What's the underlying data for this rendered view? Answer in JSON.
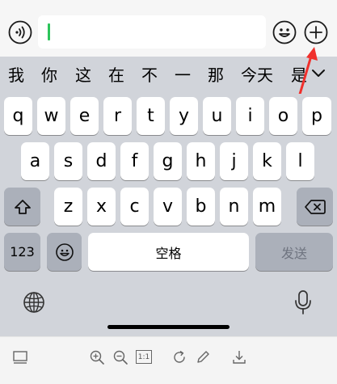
{
  "input_bar": {
    "voice_icon": "voice-input-icon",
    "emoji_icon": "emoji-icon",
    "plus_icon": "plus-icon",
    "text_value": ""
  },
  "candidates": [
    "我",
    "你",
    "这",
    "在",
    "不",
    "一",
    "那",
    "今天",
    "是"
  ],
  "annotation": {
    "arrow_color": "#f0302c"
  },
  "keyboard": {
    "row1": [
      "q",
      "w",
      "e",
      "r",
      "t",
      "y",
      "u",
      "i",
      "o",
      "p"
    ],
    "row2": [
      "a",
      "s",
      "d",
      "f",
      "g",
      "h",
      "j",
      "k",
      "l"
    ],
    "row3": [
      "z",
      "x",
      "c",
      "v",
      "b",
      "n",
      "m"
    ],
    "numbers_label": "123",
    "space_label": "空格",
    "send_label": "发送",
    "shift_icon": "shift-icon",
    "delete_icon": "backspace-icon",
    "emoji_key_icon": "emoji-icon",
    "globe_icon": "globe-icon",
    "mic_icon": "microphone-icon"
  },
  "toolbar": {
    "icons": [
      "layout-icon",
      "zoom-in-icon",
      "zoom-out-icon",
      "actual-size-icon",
      "rotate-icon",
      "edit-icon",
      "download-icon"
    ],
    "actual_size_label": "1:1"
  },
  "colors": {
    "accent_caret": "#2cc45a",
    "key_light": "#ffffff",
    "key_dark": "#abb0ba",
    "keyboard_bg": "#d1d4da"
  }
}
